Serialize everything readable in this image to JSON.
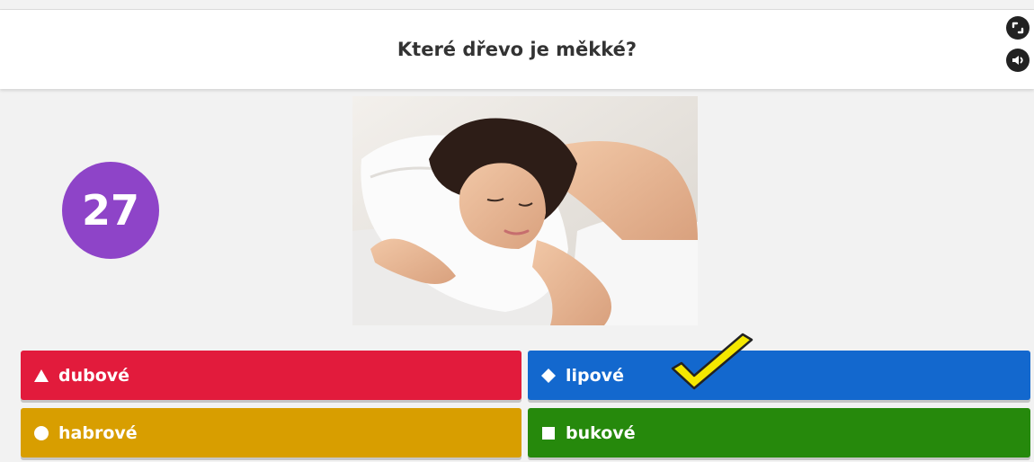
{
  "question": {
    "text": "Které dřevo je měkké?"
  },
  "controls": {
    "fullscreen_icon": "fullscreen-icon",
    "sound_icon": "speaker-icon"
  },
  "timer": {
    "value": "27",
    "color": "#8e44c8"
  },
  "answers": [
    {
      "label": "dubové",
      "shape": "triangle",
      "color": "#e21b3c"
    },
    {
      "label": "lipové",
      "shape": "diamond",
      "color": "#1368ce",
      "marked_correct": true
    },
    {
      "label": "habrové",
      "shape": "circle",
      "color": "#d89e00"
    },
    {
      "label": "bukové",
      "shape": "square",
      "color": "#26890c"
    }
  ],
  "annotation": {
    "icon": "checkmark-icon",
    "color": "#f5e800"
  }
}
